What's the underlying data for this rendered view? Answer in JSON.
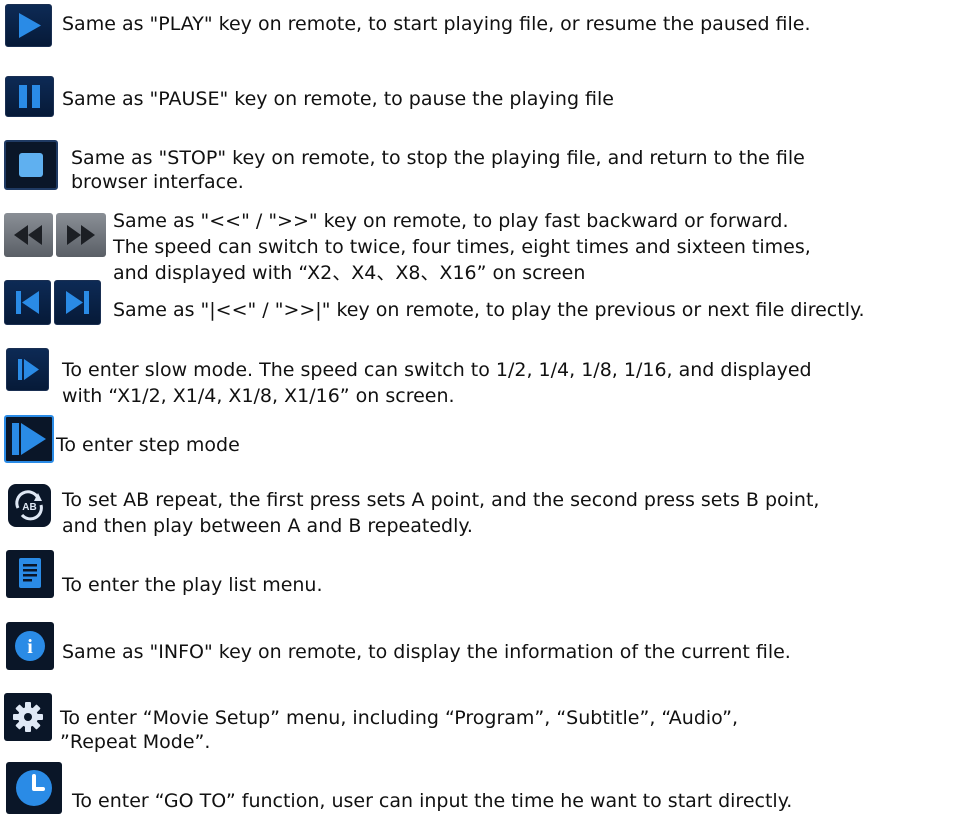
{
  "rows": [
    {
      "icon": "play-icon",
      "lines": [
        "Same as \"PLAY\" key on remote, to start playing file, or resume the paused file."
      ]
    },
    {
      "icon": "pause-icon",
      "lines": [
        "Same as \"PAUSE\" key on remote, to pause the playing file"
      ]
    },
    {
      "icon": "stop-icon",
      "lines": [
        "Same as \"STOP\" key on remote, to stop the playing file, and return to the file",
        "browser interface."
      ]
    },
    {
      "icon": "rewind-forward-icon",
      "lines": [
        "Same as \"<<\" / \">>\" key on remote, to play fast backward or forward.",
        "The speed can switch to twice, four times, eight times and sixteen times,",
        "and displayed with “X2、X4、X8、X16” on screen"
      ]
    },
    {
      "icon": "skip-prev-next-icon",
      "lines": [
        "Same as \"|<<\" / \">>|\" key on remote, to play the previous or next file directly."
      ]
    },
    {
      "icon": "slow-mode-icon",
      "lines": [
        "To enter slow mode. The speed can switch to 1/2, 1/4, 1/8, 1/16, and displayed",
        "with “X1/2, X1/4, X1/8, X1/16” on screen."
      ]
    },
    {
      "icon": "step-mode-icon",
      "lines": [
        "To enter step mode"
      ]
    },
    {
      "icon": "ab-repeat-icon",
      "icon_text": "AB",
      "lines": [
        "To set AB repeat, the first press sets A point, and the second press sets B point,",
        "and then play between A and B repeatedly."
      ]
    },
    {
      "icon": "playlist-icon",
      "lines": [
        "To enter the play list menu."
      ]
    },
    {
      "icon": "info-icon",
      "icon_text": "i",
      "lines": [
        "Same as \"INFO\" key on remote, to display the information of the current file."
      ]
    },
    {
      "icon": "gear-icon",
      "lines": [
        "To enter “Movie Setup” menu, including “Program”, “Subtitle”, “Audio”,",
        "”Repeat Mode”."
      ]
    },
    {
      "icon": "clock-icon",
      "lines": [
        "To enter “GO TO” function, user can input the time he want to start directly."
      ]
    }
  ],
  "colors": {
    "icon_blue": "#2a8be6",
    "icon_dark": "#0a1628",
    "text": "#111111"
  }
}
